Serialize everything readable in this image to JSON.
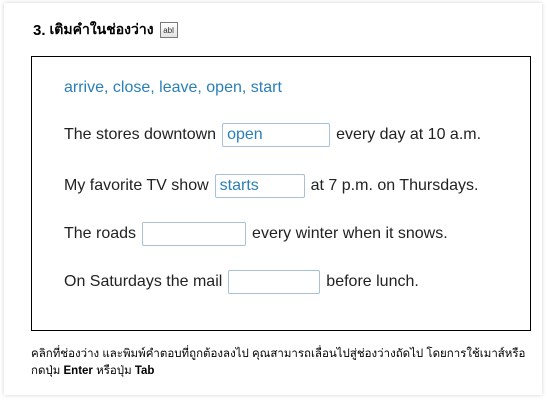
{
  "exercise": {
    "number": "3.",
    "title": "เติมคำในช่องว่าง",
    "icon_text": "abl"
  },
  "word_bank": "arrive, close, leave, open, start",
  "sentences": [
    {
      "before": "The stores downtown",
      "answer": "open",
      "after": "every day at 10 a.m."
    },
    {
      "before": "My favorite TV show",
      "answer": "starts",
      "after": "at 7 p.m. on Thursdays."
    },
    {
      "before": "The roads",
      "answer": "",
      "after": "every winter when it snows."
    },
    {
      "before": "On Saturdays the mail",
      "answer": "",
      "after": "before lunch."
    }
  ],
  "instructions": {
    "part1": "คลิกที่ช่องว่าง และพิมพ์คำตอบที่ถูกต้องลงไป คุณสามารถเลื่อนไปสู่ช่องว่างถัดไป โดยการใช้เมาส์หรือกดปุ่ม ",
    "key1": "Enter",
    "part2": " หรือปุ่ม ",
    "key2": "Tab"
  },
  "colors": {
    "word_bank": "#2a7fb8",
    "answer_text": "#2a7fb8",
    "blank_border": "#a8c1d8"
  }
}
